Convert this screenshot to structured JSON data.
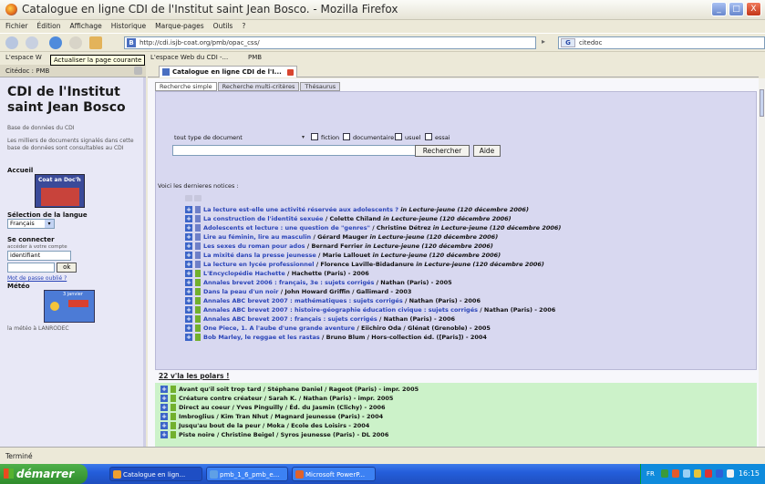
{
  "window": {
    "title": "Catalogue en ligne CDI de l'Institut saint Jean Bosco. - Mozilla Firefox",
    "btn_min": "_",
    "btn_max": "□",
    "btn_close": "X"
  },
  "menu": [
    "Fichier",
    "Édition",
    "Affichage",
    "Historique",
    "Marque-pages",
    "Outils",
    "?"
  ],
  "nav": {
    "url": "http://cdi.isjb-coat.org/pmb/opac_css/",
    "search_value": "citedoc",
    "search_engine": "G"
  },
  "bookmarks": {
    "item1": "L'espace W",
    "item2": "L'espace Web du CDI -...",
    "item3": "PMB"
  },
  "tooltip": "Actualiser la page courante",
  "sidebar": {
    "header": "Citédoc : PMB",
    "title": "CDI de l'Institut saint Jean Bosco",
    "db_label": "Base de données du CDI",
    "db_desc": "Les milliers de documents signalés dans cette base de données sont consultables au CDI",
    "accueil": "Accueil",
    "coat_text": "Coat an Doc'h",
    "langue_label": "Sélection de la langue",
    "langue_value": "Français",
    "connect_label": "Se connecter",
    "connect_sub": "accéder à votre compte",
    "login_value": "identifiant",
    "ok_label": "ok",
    "forgot": "Mot de passe oublié ?",
    "meteo_label": "Météo",
    "meteo_sub": "la météo à LANRODEC"
  },
  "browser_tab": {
    "label": "Catalogue en ligne CDI de l'I..."
  },
  "opac": {
    "tabs": [
      "Recherche simple",
      "Recherche multi-critères",
      "Thésaurus"
    ],
    "type_select": "tout type de document",
    "checkboxes": [
      "fiction",
      "documentaire",
      "usuel",
      "essai"
    ],
    "search_button": "Rechercher",
    "help_button": "Aide",
    "recent_label": "Voici les dernieres notices :",
    "notices": [
      {
        "icon": "a",
        "title": "La lecture est-elle une activité réservée aux adolescents ?",
        "author": "",
        "source": " in Lecture-jeune (120 décembre 2006)"
      },
      {
        "icon": "a",
        "title": "La construction de l'identité sexuée",
        "author": " / Colette Chiland",
        "source": " in Lecture-jeune (120 décembre 2006)"
      },
      {
        "icon": "a",
        "title": "Adolescents et lecture : une question de \"genres\"",
        "author": " / Christine Détrez",
        "source": " in Lecture-jeune (120 décembre 2006)"
      },
      {
        "icon": "a",
        "title": "Lire au féminin, lire au masculin",
        "author": " / Gérard Mauger",
        "source": " in Lecture-jeune (120 décembre 2006)"
      },
      {
        "icon": "a",
        "title": "Les sexes du roman pour ados",
        "author": " / Bernard Ferrier",
        "source": " in Lecture-jeune (120 décembre 2006)"
      },
      {
        "icon": "a",
        "title": "La mixité dans la presse jeunesse",
        "author": " / Marie Lallouet",
        "source": " in Lecture-jeune (120 décembre 2006)"
      },
      {
        "icon": "a",
        "title": "La lecture en lycée professionnel",
        "author": " / Florence Laville-Bidadanure",
        "source": " in Lecture-jeune (120 décembre 2006)"
      },
      {
        "icon": "m",
        "title": "L'Encyclopédie Hachette",
        "author": " / Hachette (Paris) - 2006",
        "source": ""
      },
      {
        "icon": "m",
        "title": "Annales brevet 2006 : français, 3e : sujets corrigés",
        "author": " / Nathan (Paris) - 2005",
        "source": ""
      },
      {
        "icon": "m",
        "title": "Dans la peau d'un noir",
        "author": " / John Howard Griffin / Gallimard - 2003",
        "source": ""
      },
      {
        "icon": "m",
        "title": "Annales ABC brevet 2007 : mathématiques : sujets corrigés",
        "author": " / Nathan (Paris) - 2006",
        "source": ""
      },
      {
        "icon": "m",
        "title": "Annales ABC brevet 2007 : histoire-géographie éducation civique : sujets corrigés",
        "author": " / Nathan (Paris) - 2006",
        "source": ""
      },
      {
        "icon": "m",
        "title": "Annales ABC brevet 2007 : français : sujets corrigés",
        "author": " / Nathan (Paris) - 2006",
        "source": ""
      },
      {
        "icon": "m",
        "title": "One Piece, 1. A l'aube d'une grande aventure",
        "author": " / Eiichiro Oda / Glénat (Grenoble) - 2005",
        "source": ""
      },
      {
        "icon": "m",
        "title": "Bob Marley, le reggae et les rastas",
        "author": " / Bruno Blum / Hors-collection éd. ([Paris]) - 2004",
        "source": ""
      }
    ],
    "polars_heading": "22 v'la les polars !",
    "polars": [
      "Avant qu'il soit trop tard / Stéphane Daniel / Rageot (Paris) - impr. 2005",
      "Créature contre créateur / Sarah K. / Nathan (Paris) - impr. 2005",
      "Direct au coeur / Yves Pinguilly / Éd. du Jasmin (Clichy) - 2006",
      "Imbroglius / Kim Tran Nhut / Magnard jeunesse (Paris) - 2004",
      "Jusqu'au bout de la peur / Moka / Ecole des Loisirs - 2004",
      "Piste noire / Christine Beigel / Syros jeunesse (Paris) - DL 2006"
    ]
  },
  "status": "Terminé",
  "taskbar": {
    "start": "démarrer",
    "tasks": [
      "Catalogue en lign...",
      "pmb_1_6_pmb_e...",
      "Microsoft PowerP..."
    ],
    "clock": "16:15",
    "lang": "FR"
  },
  "colors": {
    "title_link": "#2a44b8",
    "search_panel": "#d8d8f0",
    "polars_bg": "#ccf2c9"
  }
}
